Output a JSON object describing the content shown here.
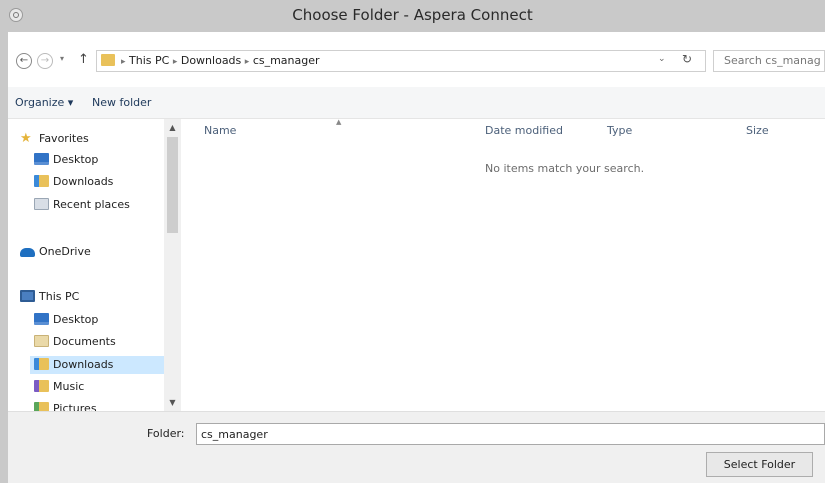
{
  "window": {
    "title": "Choose Folder - Aspera Connect"
  },
  "navigation": {
    "breadcrumb": [
      "This PC",
      "Downloads",
      "cs_manager"
    ],
    "separator": "▸",
    "search_placeholder": "Search cs_manag",
    "back_glyph": "←",
    "forward_glyph": "→",
    "recent_glyph": "▾",
    "up_glyph": "↑",
    "dropdown_glyph": "⌄",
    "refresh_glyph": "↻"
  },
  "toolbar": {
    "organize_label": "Organize ▾",
    "new_folder_label": "New folder"
  },
  "nav_pane": {
    "items": [
      {
        "label": "Favorites",
        "icon": "star-icon",
        "selected": false
      },
      {
        "label": "Desktop",
        "icon": "desktop-icon",
        "selected": false
      },
      {
        "label": "Downloads",
        "icon": "downloads-icon",
        "selected": false
      },
      {
        "label": "Recent places",
        "icon": "recent-places-icon",
        "selected": false
      },
      {
        "label": "OneDrive",
        "icon": "onedrive-icon",
        "selected": false
      },
      {
        "label": "This PC",
        "icon": "computer-icon",
        "selected": false
      },
      {
        "label": "Desktop",
        "icon": "desktop-icon",
        "selected": false
      },
      {
        "label": "Documents",
        "icon": "documents-icon",
        "selected": false
      },
      {
        "label": "Downloads",
        "icon": "downloads-icon",
        "selected": true
      },
      {
        "label": "Music",
        "icon": "music-icon",
        "selected": false
      },
      {
        "label": "Pictures",
        "icon": "pictures-icon",
        "selected": false
      }
    ],
    "scroll_up_glyph": "▲",
    "scroll_down_glyph": "▼"
  },
  "file_list": {
    "columns": [
      "Name",
      "Date modified",
      "Type",
      "Size"
    ],
    "sort_glyph": "▲",
    "empty_message": "No items match your search."
  },
  "footer": {
    "folder_label": "Folder:",
    "folder_value": "cs_manager",
    "select_button_label": "Select Folder"
  },
  "colors": {
    "titlebar": "#c9c9c9",
    "selection": "#cce8ff",
    "link_text": "#1e395b"
  }
}
